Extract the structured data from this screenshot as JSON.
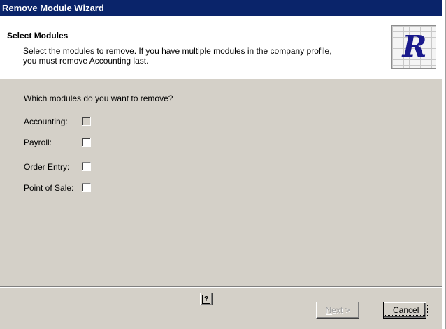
{
  "window": {
    "title": "Remove Module Wizard"
  },
  "header": {
    "title": "Select Modules",
    "description_line1": "Select the modules to remove. If you have multiple modules in the company profile,",
    "description_line2": "you must remove Accounting last.",
    "logo_letter": "R"
  },
  "body": {
    "question": "Which modules do you want to remove?",
    "modules": [
      {
        "label": "Accounting:",
        "checked": false,
        "enabled": false
      },
      {
        "label": "Payroll:",
        "checked": false,
        "enabled": true
      },
      {
        "label": "Order Entry:",
        "checked": false,
        "enabled": true
      },
      {
        "label": "Point of Sale:",
        "checked": false,
        "enabled": true
      }
    ]
  },
  "footer": {
    "help_label": "?",
    "next_label_underlined": "N",
    "next_label_rest": "ext >",
    "cancel_label_underlined": "C",
    "cancel_label_rest": "ancel"
  },
  "colors": {
    "titlebar": "#0a246a",
    "dialog_face": "#d4d0c8",
    "header_bg": "#ffffff"
  }
}
